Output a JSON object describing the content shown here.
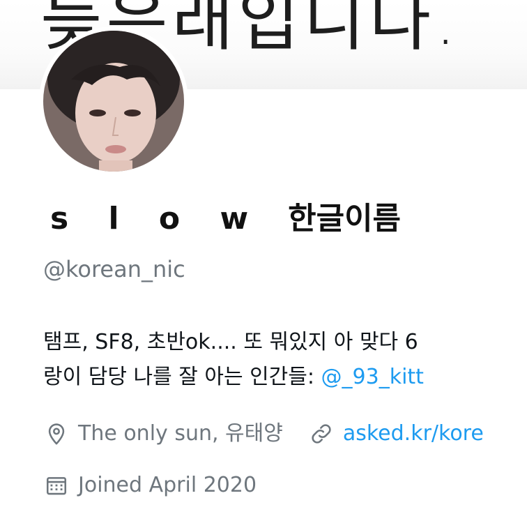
{
  "banner": {
    "text": "늦은래입니다."
  },
  "profile": {
    "display_name_latin": "s l o w",
    "display_name_korean": "한글이름",
    "handle": "@korean_nic",
    "bio_line1": "탬프, SF8, 초반ok.... 또 뭐있지 아 맞다 6",
    "bio_line2_text": "랑이 담당 나를 잘 아는 인간들: ",
    "bio_line2_mention": "@_93_kitt",
    "location": "The only sun, 유태양",
    "website": "asked.kr/kore",
    "joined": "Joined April 2020"
  },
  "icons": {
    "location": "location-pin-icon",
    "link": "link-icon",
    "calendar": "calendar-icon"
  },
  "colors": {
    "accent": "#1d9bf0",
    "secondary_text": "#6e767d",
    "primary_text": "#0f1419"
  }
}
